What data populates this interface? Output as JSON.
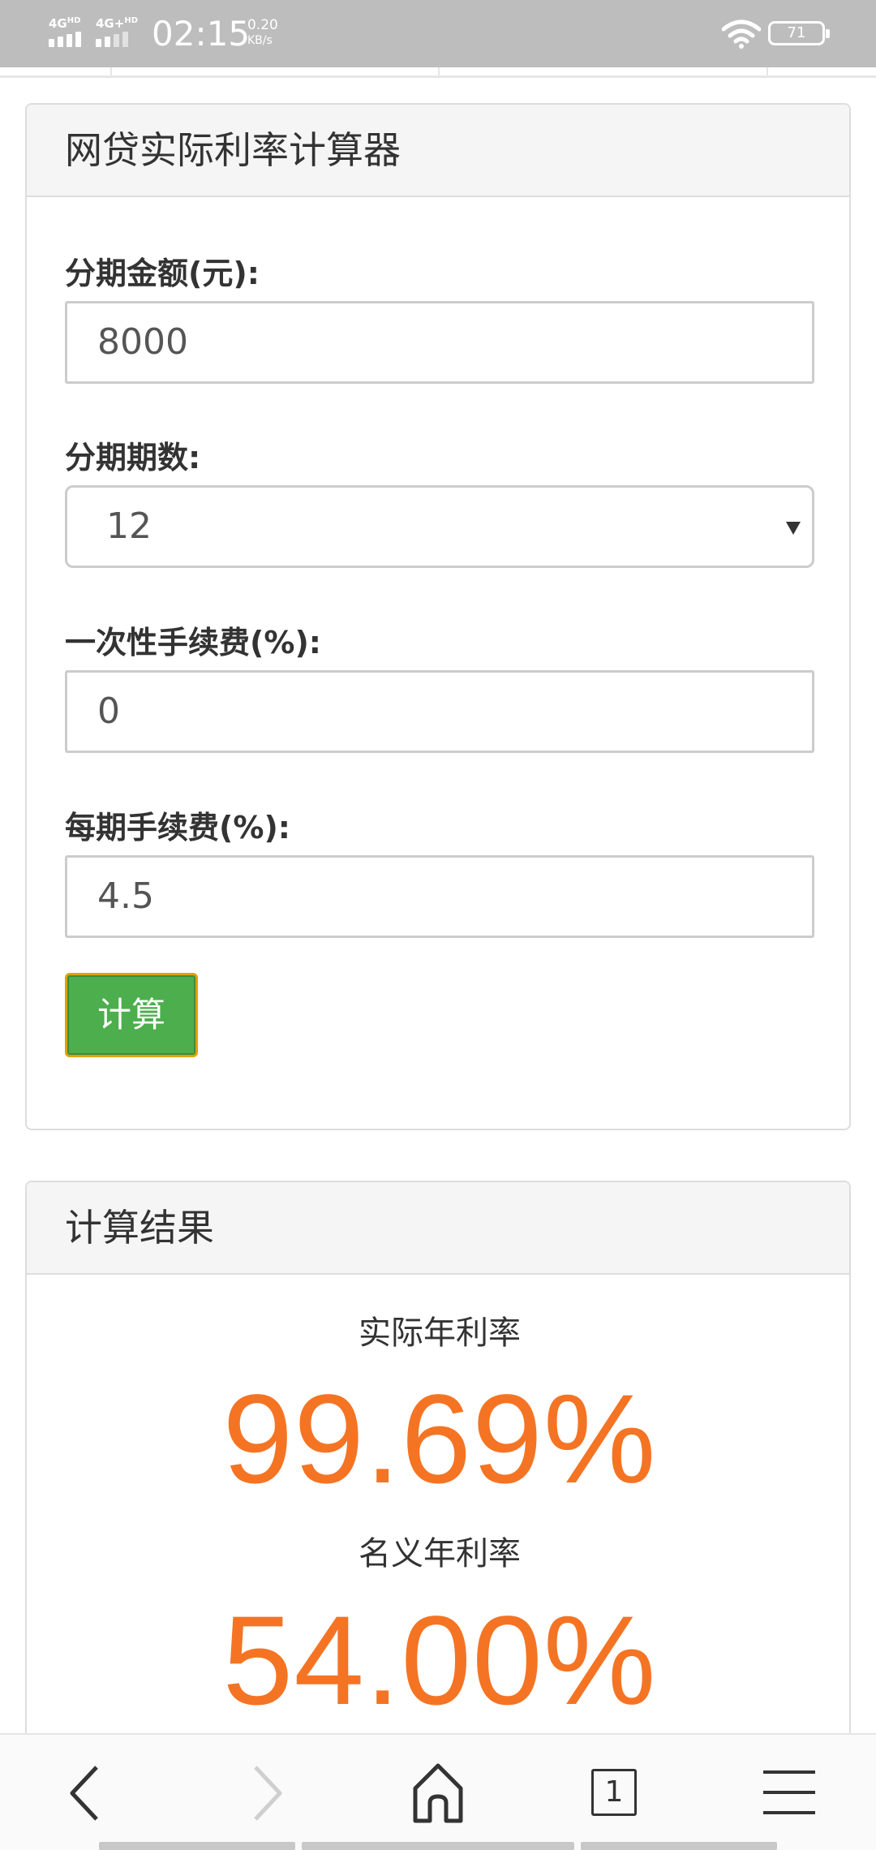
{
  "status_bar": {
    "network1": "4G",
    "network1_sup": "HD",
    "network2": "4G+",
    "network2_sup": "HD",
    "time": "02:15",
    "speed_value": "0.20",
    "speed_unit": "KB/s",
    "battery": "71"
  },
  "calculator": {
    "title": "网贷实际利率计算器",
    "amount_label": "分期金额(元):",
    "amount_value": "8000",
    "periods_label": "分期期数:",
    "periods_value": "12",
    "one_time_fee_label": "一次性手续费(%):",
    "one_time_fee_value": "0",
    "per_period_fee_label": "每期手续费(%):",
    "per_period_fee_value": "4.5",
    "calculate_button": "计算"
  },
  "results": {
    "title": "计算结果",
    "actual_rate_label": "实际年利率",
    "actual_rate_value": "99.69%",
    "nominal_rate_label": "名义年利率",
    "nominal_rate_value": "54.00%",
    "accent_color": "#f47424"
  },
  "browser_bar": {
    "tab_count": "1",
    "icons": [
      "back-icon",
      "forward-icon",
      "home-icon",
      "tabs-icon",
      "menu-icon"
    ]
  }
}
